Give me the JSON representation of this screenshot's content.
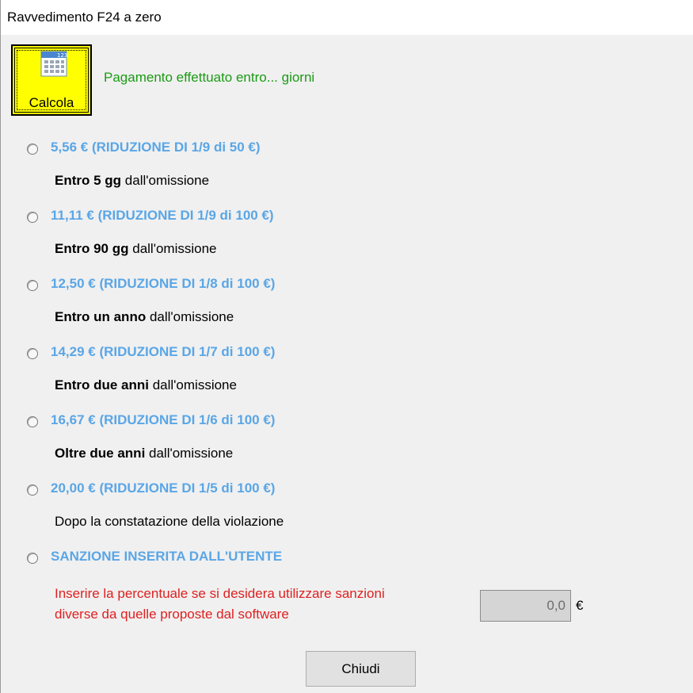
{
  "window": {
    "title": "Ravvedimento F24 a zero"
  },
  "calc_button": {
    "label": "Calcola",
    "icon": "calculator-icon",
    "color": "#ffff00"
  },
  "subtitle": "Pagamento effettuato entro... giorni",
  "options": [
    {
      "label": "5,56 € (RIDUZIONE DI 1/9 di 50 €)",
      "desc_bold": "Entro 5 gg",
      "desc_rest": " dall'omissione"
    },
    {
      "label": "11,11 € (RIDUZIONE DI 1/9 di 100 €)",
      "desc_bold": "Entro 90 gg",
      "desc_rest": " dall'omissione"
    },
    {
      "label": "12,50 € (RIDUZIONE DI 1/8 di 100 €)",
      "desc_bold": "Entro un anno",
      "desc_rest": " dall'omissione"
    },
    {
      "label": "14,29 € (RIDUZIONE DI 1/7 di 100 €)",
      "desc_bold": "Entro due anni",
      "desc_rest": " dall'omissione"
    },
    {
      "label": "16,67 € (RIDUZIONE DI 1/6 di 100 €)",
      "desc_bold": "Oltre due anni",
      "desc_rest": " dall'omissione"
    },
    {
      "label": "20,00 € (RIDUZIONE DI 1/5 di 100 €)",
      "desc_bold": "",
      "desc_rest": "Dopo la constatazione della violazione"
    },
    {
      "label": "SANZIONE INSERITA DALL'UTENTE"
    }
  ],
  "custom": {
    "warning_line1": "Inserire la percentuale se si desidera utilizzare sanzioni",
    "warning_line2": "diverse da quelle proposte dal software",
    "value": "0,0",
    "unit": "€"
  },
  "close_button": {
    "label": "Chiudi"
  },
  "colors": {
    "option_label": "#5aa6e6",
    "subtitle": "#1b9b14",
    "warning": "#e02020"
  }
}
